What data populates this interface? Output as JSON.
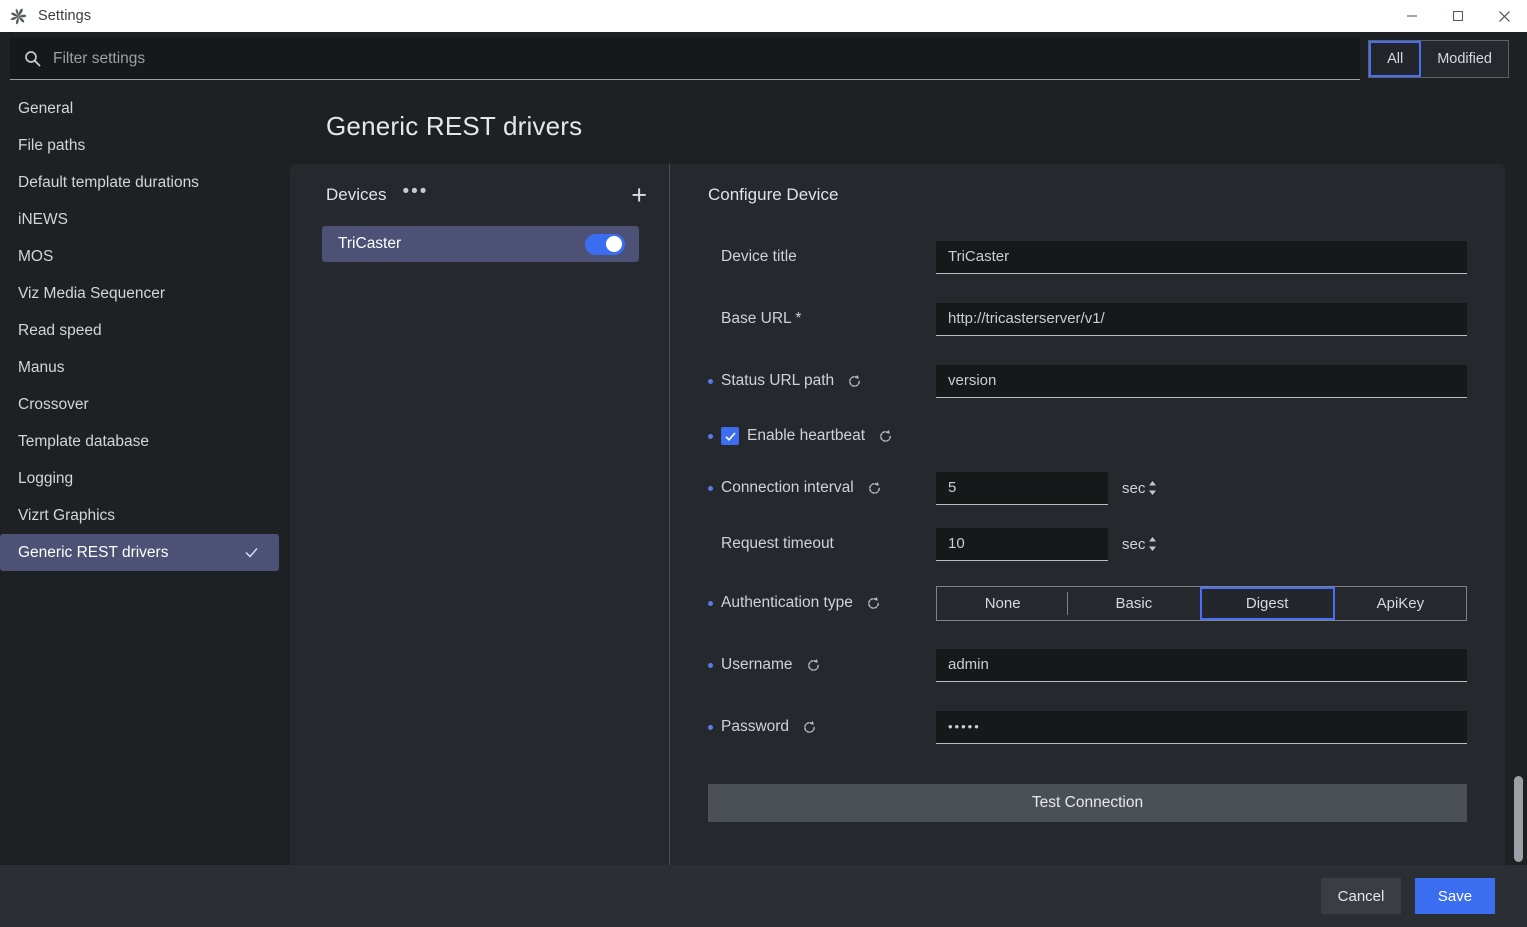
{
  "window": {
    "title": "Settings",
    "logo_icon": "pinwheel-logo-icon",
    "minimize_icon": "minimize-icon",
    "maximize_icon": "maximize-icon",
    "close_icon": "close-icon"
  },
  "search": {
    "placeholder": "Filter settings",
    "value": "",
    "icon": "search-icon"
  },
  "filter_toggle": {
    "options": [
      "All",
      "Modified"
    ],
    "selected": "All"
  },
  "sidebar": {
    "items": [
      {
        "label": "General",
        "active": false
      },
      {
        "label": "File paths",
        "active": false
      },
      {
        "label": "Default template durations",
        "active": false
      },
      {
        "label": "iNEWS",
        "active": false
      },
      {
        "label": "MOS",
        "active": false
      },
      {
        "label": "Viz Media Sequencer",
        "active": false
      },
      {
        "label": "Read speed",
        "active": false
      },
      {
        "label": "Manus",
        "active": false
      },
      {
        "label": "Crossover",
        "active": false
      },
      {
        "label": "Template database",
        "active": false
      },
      {
        "label": "Logging",
        "active": false
      },
      {
        "label": "Vizrt Graphics",
        "active": false
      },
      {
        "label": "Generic REST drivers",
        "active": true
      }
    ]
  },
  "page": {
    "title": "Generic REST drivers"
  },
  "devices": {
    "title": "Devices",
    "more_icon": "more-dots-icon",
    "add_icon": "plus-icon",
    "list": [
      {
        "name": "TriCaster",
        "enabled": true
      }
    ]
  },
  "configure": {
    "title": "Configure Device",
    "reset_icon": "reset-icon",
    "fields": {
      "device_title": {
        "label": "Device title",
        "value": "TriCaster",
        "modified": false,
        "has_reset": false
      },
      "base_url": {
        "label": "Base URL *",
        "value": "http://tricasterserver/v1/",
        "modified": false,
        "has_reset": false
      },
      "status_url_path": {
        "label": "Status URL path",
        "value": "version",
        "modified": true,
        "has_reset": true
      },
      "enable_heartbeat": {
        "label": "Enable heartbeat",
        "checked": true,
        "modified": true,
        "has_reset": true
      },
      "connection_interval": {
        "label": "Connection interval",
        "value": "5",
        "unit": "sec",
        "modified": true,
        "has_reset": true
      },
      "request_timeout": {
        "label": "Request timeout",
        "value": "10",
        "unit": "sec",
        "modified": false,
        "has_reset": false
      },
      "authentication_type": {
        "label": "Authentication type",
        "options": [
          "None",
          "Basic",
          "Digest",
          "ApiKey"
        ],
        "selected": "Digest",
        "modified": true,
        "has_reset": true
      },
      "username": {
        "label": "Username",
        "value": "admin",
        "modified": true,
        "has_reset": true
      },
      "password": {
        "label": "Password",
        "value": "•••••",
        "modified": true,
        "has_reset": true
      }
    },
    "test_connection_label": "Test Connection"
  },
  "footer": {
    "cancel_label": "Cancel",
    "save_label": "Save"
  },
  "colors": {
    "accent_blue": "#3b6df0",
    "selection_purple": "#4c5175",
    "focus_border": "#4a6ef5",
    "window_bg": "#1e2124",
    "panel_bg": "#25282c",
    "footer_bg": "#2b2f33"
  }
}
